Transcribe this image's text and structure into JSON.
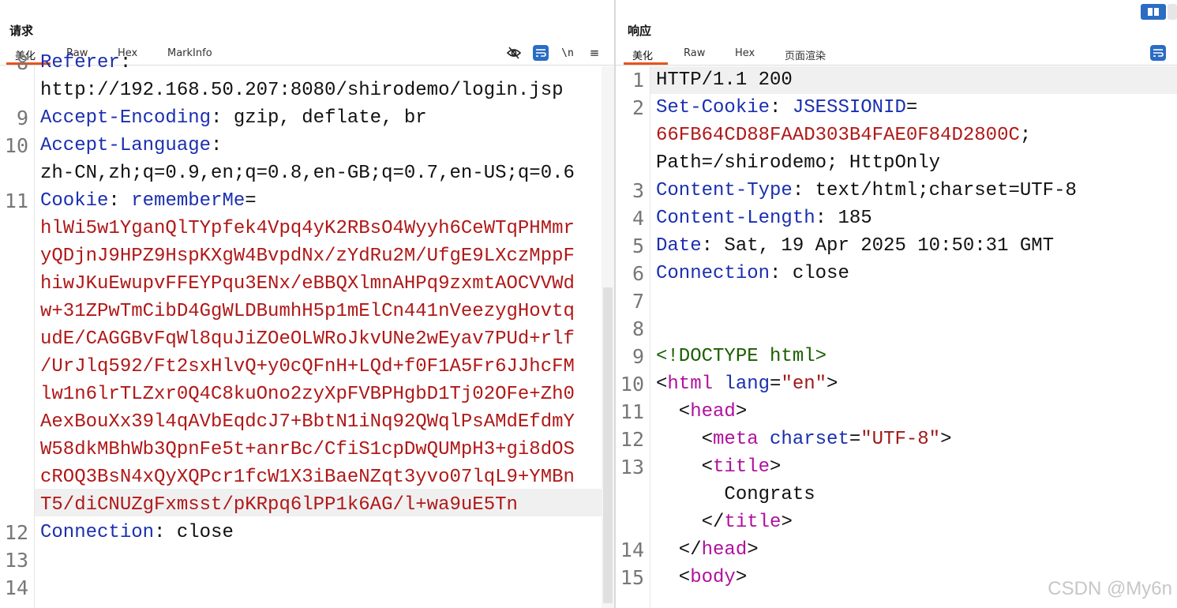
{
  "request": {
    "title": "请求",
    "tabs": [
      "美化",
      "Raw",
      "Hex",
      "MarkInfo"
    ],
    "toolbar": {
      "hide_icon": "eye-slash-icon",
      "wrap_icon": "wrap-icon",
      "newline_label": "\\n",
      "menu_label": "≡"
    },
    "lines": [
      {
        "n": "8",
        "parts": [
          [
            "k",
            "Referer"
          ],
          [
            "v",
            ":"
          ]
        ]
      },
      {
        "n": "",
        "parts": [
          [
            "v",
            "http://192.168.50.207:8080/shirodemo/login.jsp"
          ]
        ]
      },
      {
        "n": "9",
        "parts": [
          [
            "k",
            "Accept-Encoding"
          ],
          [
            "v",
            ": gzip, deflate, br"
          ]
        ]
      },
      {
        "n": "10",
        "parts": [
          [
            "k",
            "Accept-Language"
          ],
          [
            "v",
            ":"
          ]
        ]
      },
      {
        "n": "",
        "parts": [
          [
            "v",
            "zh-CN,zh;q=0.9,en;q=0.8,en-GB;q=0.7,en-US;q=0.6"
          ]
        ]
      },
      {
        "n": "11",
        "parts": [
          [
            "k",
            "Cookie"
          ],
          [
            "v",
            ": "
          ],
          [
            "k",
            "rememberMe"
          ],
          [
            "v",
            "="
          ]
        ]
      },
      {
        "n": "",
        "parts": [
          [
            "r",
            "hlWi5w1YganQlTYpfek4Vpq4yK2RBsO4Wyyh6CeWTqPHMmr"
          ]
        ]
      },
      {
        "n": "",
        "parts": [
          [
            "r",
            "yQDjnJ9HPZ9HspKXgW4BvpdNx/zYdRu2M/UfgE9LXczMppF"
          ]
        ]
      },
      {
        "n": "",
        "parts": [
          [
            "r",
            "hiwJKuEwupvFFEYPqu3ENx/eBBQXlmnAHPq9zxmtAOCVVWd"
          ]
        ]
      },
      {
        "n": "",
        "parts": [
          [
            "r",
            "w+31ZPwTmCibD4GgWLDBumhH5p1mElCn441nVeezygHovtq"
          ]
        ]
      },
      {
        "n": "",
        "parts": [
          [
            "r",
            "udE/CAGGBvFqWl8quJiZOeOLWRoJkvUNe2wEyav7PUd+rlf"
          ]
        ]
      },
      {
        "n": "",
        "parts": [
          [
            "r",
            "/UrJlq592/Ft2sxHlvQ+y0cQFnH+LQd+f0F1A5Fr6JJhcFM"
          ]
        ]
      },
      {
        "n": "",
        "parts": [
          [
            "r",
            "lw1n6lrTLZxr0Q4C8kuOno2zyXpFVBPHgbD1Tj02OFe+Zh0"
          ]
        ]
      },
      {
        "n": "",
        "parts": [
          [
            "r",
            "AexBouXx39l4qAVbEqdcJ7+BbtN1iNq92QWqlPsAMdEfdmY"
          ]
        ]
      },
      {
        "n": "",
        "parts": [
          [
            "r",
            "W58dkMBhWb3QpnFe5t+anrBc/CfiS1cpDwQUMpH3+gi8dOS"
          ]
        ]
      },
      {
        "n": "",
        "parts": [
          [
            "r",
            "cROQ3BsN4xQyXQPcr1fcW1X3iBaeNZqt3yvo07lqL9+YMBn"
          ]
        ]
      },
      {
        "n": "",
        "parts": [
          [
            "r",
            "T5/diCNUZgFxmsst/pKRpq6lPP1k6AG/l+wa9uE5Tn"
          ]
        ]
      },
      {
        "n": "12",
        "parts": [
          [
            "k",
            "Connection"
          ],
          [
            "v",
            ": close"
          ]
        ]
      },
      {
        "n": "13",
        "parts": []
      },
      {
        "n": "14",
        "parts": []
      }
    ]
  },
  "response": {
    "title": "响应",
    "tabs": [
      "美化",
      "Raw",
      "Hex",
      "页面渲染"
    ],
    "toolbar": {
      "wrap_icon": "wrap-icon"
    },
    "lines": [
      {
        "n": "1",
        "parts": [
          [
            "v",
            "HTTP/1.1 200"
          ]
        ]
      },
      {
        "n": "2",
        "parts": [
          [
            "k",
            "Set-Cookie"
          ],
          [
            "v",
            ": "
          ],
          [
            "k",
            "JSESSIONID"
          ],
          [
            "v",
            "="
          ]
        ]
      },
      {
        "n": "",
        "parts": [
          [
            "r",
            "66FB64CD88FAAD303B4FAE0F84D2800C"
          ],
          [
            "v",
            ";"
          ]
        ]
      },
      {
        "n": "",
        "parts": [
          [
            "v",
            "Path=/shirodemo; HttpOnly"
          ]
        ]
      },
      {
        "n": "3",
        "parts": [
          [
            "k",
            "Content-Type"
          ],
          [
            "v",
            ": text/html;charset=UTF-8"
          ]
        ]
      },
      {
        "n": "4",
        "parts": [
          [
            "k",
            "Content-Length"
          ],
          [
            "v",
            ": 185"
          ]
        ]
      },
      {
        "n": "5",
        "parts": [
          [
            "k",
            "Date"
          ],
          [
            "v",
            ": Sat, 19 Apr 2025 10:50:31 GMT"
          ]
        ]
      },
      {
        "n": "6",
        "parts": [
          [
            "k",
            "Connection"
          ],
          [
            "v",
            ": close"
          ]
        ]
      },
      {
        "n": "7",
        "parts": []
      },
      {
        "n": "8",
        "parts": []
      },
      {
        "n": "9",
        "parts": [
          [
            "tg",
            "<!DOCTYPE html>"
          ]
        ]
      },
      {
        "n": "10",
        "parts": [
          [
            "v",
            "<"
          ],
          [
            "tag",
            "html"
          ],
          [
            "v",
            " "
          ],
          [
            "attr",
            "lang"
          ],
          [
            "v",
            "="
          ],
          [
            "str",
            "\"en\""
          ],
          [
            "v",
            ">"
          ]
        ]
      },
      {
        "n": "11",
        "parts": [
          [
            "v",
            "  <"
          ],
          [
            "tag",
            "head"
          ],
          [
            "v",
            ">"
          ]
        ]
      },
      {
        "n": "12",
        "parts": [
          [
            "v",
            "    <"
          ],
          [
            "tag",
            "meta"
          ],
          [
            "v",
            " "
          ],
          [
            "attr",
            "charset"
          ],
          [
            "v",
            "="
          ],
          [
            "str",
            "\"UTF-8\""
          ],
          [
            "v",
            ">"
          ]
        ]
      },
      {
        "n": "13",
        "parts": [
          [
            "v",
            "    <"
          ],
          [
            "tag",
            "title"
          ],
          [
            "v",
            ">"
          ]
        ]
      },
      {
        "n": "",
        "parts": [
          [
            "v",
            "      Congrats"
          ]
        ]
      },
      {
        "n": "",
        "parts": [
          [
            "v",
            "    </"
          ],
          [
            "tag",
            "title"
          ],
          [
            "v",
            ">"
          ]
        ]
      },
      {
        "n": "14",
        "parts": [
          [
            "v",
            "  </"
          ],
          [
            "tag",
            "head"
          ],
          [
            "v",
            ">"
          ]
        ]
      },
      {
        "n": "15",
        "parts": [
          [
            "v",
            "  <"
          ],
          [
            "tag",
            "body"
          ],
          [
            "v",
            ">"
          ]
        ]
      }
    ]
  },
  "watermark": "CSDN @My6n",
  "layout_icon": "split-view-icon"
}
